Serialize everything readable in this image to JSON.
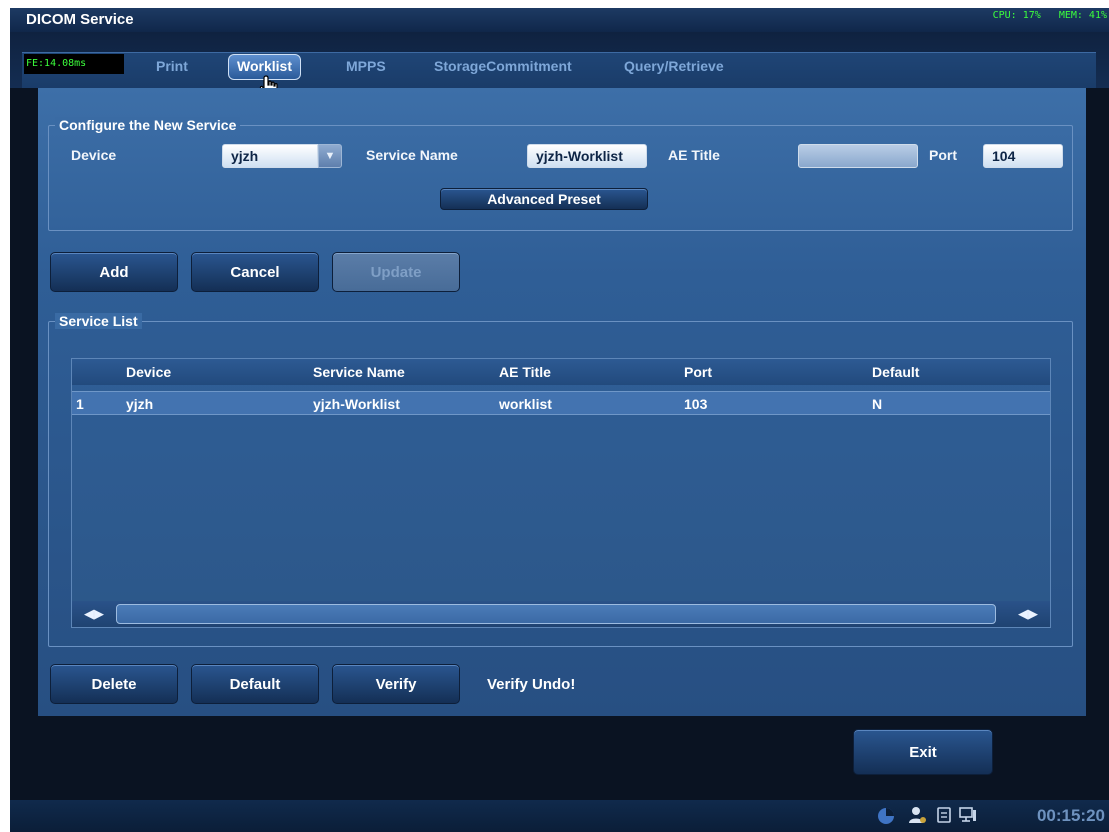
{
  "window": {
    "title": "DICOM Service"
  },
  "system": {
    "cpu": "CPU: 17%",
    "mem": "MEM: 41%",
    "frame_time": "FE:14.08ms"
  },
  "tabs": [
    {
      "label": "Print"
    },
    {
      "label": "Worklist",
      "active": true
    },
    {
      "label": "MPPS"
    },
    {
      "label": "StorageCommitment"
    },
    {
      "label": "Query/Retrieve"
    }
  ],
  "config": {
    "legend": "Configure the New Service",
    "device_label": "Device",
    "device_value": "yjzh",
    "service_name_label": "Service Name",
    "service_name_value": "yjzh-Worklist",
    "ae_title_label": "AE Title",
    "ae_title_value": "",
    "port_label": "Port",
    "port_value": "104",
    "advanced_preset": "Advanced Preset"
  },
  "actions": {
    "add": "Add",
    "cancel": "Cancel",
    "update": "Update"
  },
  "service_list": {
    "legend": "Service List",
    "columns": [
      "Device",
      "Service Name",
      "AE Title",
      "Port",
      "Default"
    ],
    "rows": [
      {
        "index": "1",
        "device": "yjzh",
        "service_name": "yjzh-Worklist",
        "ae_title": "worklist",
        "port": "103",
        "default": "N"
      }
    ]
  },
  "bottom_actions": {
    "delete": "Delete",
    "default": "Default",
    "verify": "Verify",
    "verify_status": "Verify Undo!"
  },
  "exit": "Exit",
  "clock": "00:15:20",
  "colors": {
    "panel": "#2f5e96",
    "accent_green": "#3cff3c",
    "titlebar": "#1d3a63"
  }
}
